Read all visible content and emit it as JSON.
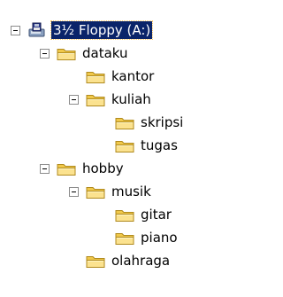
{
  "tree": {
    "root": {
      "label": "3½ Floppy (A:)",
      "icon": "floppy-drive-icon",
      "expanded": true,
      "selected": true
    },
    "nodes": [
      {
        "label": "dataku",
        "icon": "folder-icon",
        "expanded": true
      },
      {
        "label": "kantor",
        "icon": "folder-icon"
      },
      {
        "label": "kuliah",
        "icon": "folder-icon",
        "expanded": true
      },
      {
        "label": "skripsi",
        "icon": "folder-icon"
      },
      {
        "label": "tugas",
        "icon": "folder-icon"
      },
      {
        "label": "hobby",
        "icon": "folder-icon",
        "expanded": true
      },
      {
        "label": "musik",
        "icon": "folder-icon",
        "expanded": true
      },
      {
        "label": "gitar",
        "icon": "folder-icon"
      },
      {
        "label": "piano",
        "icon": "folder-icon"
      },
      {
        "label": "olahraga",
        "icon": "folder-icon"
      }
    ]
  },
  "colors": {
    "selection": "#0a246a",
    "folder": "#f6d66b"
  }
}
